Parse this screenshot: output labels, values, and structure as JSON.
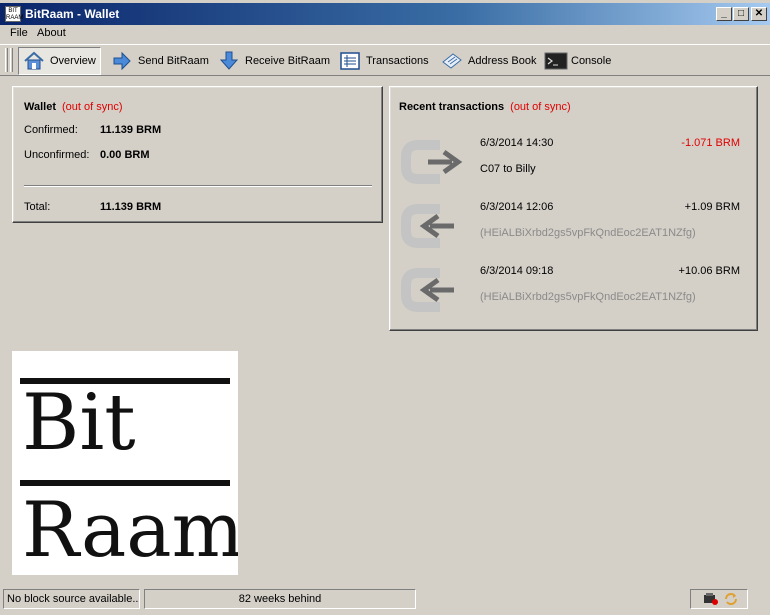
{
  "window": {
    "title": "BitRaam - Wallet",
    "icon_text": "BIT RAAM"
  },
  "titlebar_buttons": {
    "minimize": "_",
    "maximize": "□",
    "close": "✕"
  },
  "menu": {
    "items": [
      "File",
      "About"
    ]
  },
  "toolbar": {
    "items": [
      {
        "label": "Overview",
        "icon": "home-icon",
        "active": true
      },
      {
        "label": "Send BitRaam",
        "icon": "send-arrow-icon"
      },
      {
        "label": "Receive BitRaam",
        "icon": "receive-arrow-icon"
      },
      {
        "label": "Transactions",
        "icon": "list-icon"
      },
      {
        "label": "Address Book",
        "icon": "address-book-icon"
      },
      {
        "label": "Console",
        "icon": "console-icon"
      }
    ]
  },
  "wallet": {
    "title": "Wallet",
    "sync_status": "(out of sync)",
    "confirmed_label": "Confirmed:",
    "confirmed_value": "11.139 BRM",
    "unconfirmed_label": "Unconfirmed:",
    "unconfirmed_value": "0.00 BRM",
    "total_label": "Total:",
    "total_value": "11.139 BRM"
  },
  "recent": {
    "title": "Recent transactions",
    "sync_status": "(out of sync)",
    "transactions": [
      {
        "date": "6/3/2014 14:30",
        "amount": "-1.071 BRM",
        "description": "C07 to Billy",
        "direction": "out",
        "amount_color": "#e00000"
      },
      {
        "date": "6/3/2014 12:06",
        "amount": "+1.09 BRM",
        "description": "(HEiALBiXrbd2gs5vpFkQndEoc2EAT1NZfg)",
        "direction": "in",
        "amount_color": "#000000"
      },
      {
        "date": "6/3/2014 09:18",
        "amount": "+10.06 BRM",
        "description": "(HEiALBiXrbd2gs5vpFkQndEoc2EAT1NZfg)",
        "direction": "in",
        "amount_color": "#000000"
      }
    ]
  },
  "logo": {
    "line1": "Bit",
    "line2": "Raam"
  },
  "statusbar": {
    "block_source": "No block source available...",
    "sync_progress": "82 weeks behind"
  },
  "colors": {
    "sync_warning": "#e00000",
    "titlebar": "#0a246a",
    "muted_text": "#8a8a8a"
  }
}
